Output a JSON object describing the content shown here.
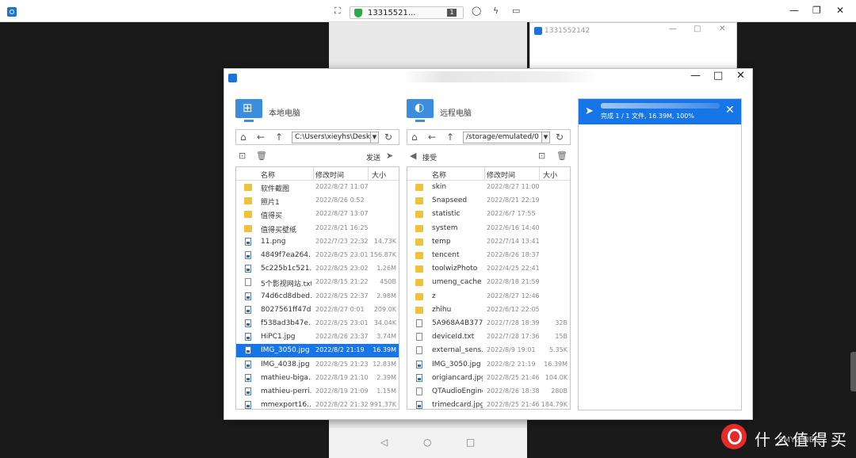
{
  "topbar": {
    "device_id": "13315521...",
    "connection_count": "1",
    "icons": [
      "fullscreen-icon",
      "shield-icon",
      "chat-icon",
      "flash-icon",
      "monitor-icon"
    ]
  },
  "bg_window": {
    "title": "1331552142"
  },
  "dialog": {
    "local": {
      "title": "本地电脑",
      "path": "C:\\Users\\xieyhs\\Desktop",
      "send_label": "发送",
      "columns": [
        "名称",
        "修改时间",
        "大小"
      ],
      "files": [
        {
          "name": "软件截图",
          "time": "2022/8/27 11:07",
          "size": "",
          "type": "folder"
        },
        {
          "name": "照片1",
          "time": "2022/8/26 0:52",
          "size": "",
          "type": "folder"
        },
        {
          "name": "值得买",
          "time": "2022/8/27 13:07",
          "size": "",
          "type": "folder"
        },
        {
          "name": "值得买壁纸",
          "time": "2022/8/21 16:25",
          "size": "",
          "type": "folder"
        },
        {
          "name": "11.png",
          "time": "2022/7/23 22:32",
          "size": "14.73K",
          "type": "img"
        },
        {
          "name": "4849f7ea264...",
          "time": "2022/8/25 23:01",
          "size": "156.87K",
          "type": "img"
        },
        {
          "name": "5c225b1c521...",
          "time": "2022/8/25 23:02",
          "size": "1.26M",
          "type": "img"
        },
        {
          "name": "5个影视网站.txt",
          "time": "2022/8/15 21:22",
          "size": "450B",
          "type": "file"
        },
        {
          "name": "74d6cd8dbed...",
          "time": "2022/8/25 22:37",
          "size": "2.98M",
          "type": "img"
        },
        {
          "name": "8027561ff47d...",
          "time": "2022/8/27 0:01",
          "size": "209.0K",
          "type": "img"
        },
        {
          "name": "f538ad3b47e...",
          "time": "2022/8/25 23:01",
          "size": "34.04K",
          "type": "img"
        },
        {
          "name": "HiPC1.jpg",
          "time": "2022/8/26 23:37",
          "size": "3.74M",
          "type": "img"
        },
        {
          "name": "IMG_3050.jpg",
          "time": "2022/8/2 21:19",
          "size": "16.39M",
          "type": "img",
          "selected": true
        },
        {
          "name": "IMG_4038.jpg",
          "time": "2022/8/25 21:23",
          "size": "12.83M",
          "type": "img"
        },
        {
          "name": "mathieu-biga...",
          "time": "2022/8/19 21:10",
          "size": "2.39M",
          "type": "img"
        },
        {
          "name": "mathieu-perri...",
          "time": "2022/8/19 21:09",
          "size": "1.15M",
          "type": "img"
        },
        {
          "name": "mmexport16...",
          "time": "2022/8/22 21:32",
          "size": "991.37K",
          "type": "img"
        }
      ]
    },
    "remote": {
      "title": "远程电脑",
      "path": "/storage/emulated/0",
      "receive_label": "接受",
      "columns": [
        "名称",
        "修改时间",
        "大小"
      ],
      "files": [
        {
          "name": "skin",
          "time": "2022/8/27 11:00",
          "size": "",
          "type": "folder"
        },
        {
          "name": "Snapseed",
          "time": "2022/8/21 22:19",
          "size": "",
          "type": "folder"
        },
        {
          "name": "statistic",
          "time": "2022/6/7 17:55",
          "size": "",
          "type": "folder"
        },
        {
          "name": "system",
          "time": "2022/6/16 14:40",
          "size": "",
          "type": "folder"
        },
        {
          "name": "temp",
          "time": "2022/7/14 13:41",
          "size": "",
          "type": "folder"
        },
        {
          "name": "tencent",
          "time": "2022/8/26 18:37",
          "size": "",
          "type": "folder"
        },
        {
          "name": "toolwizPhoto",
          "time": "2022/4/25 22:41",
          "size": "",
          "type": "folder"
        },
        {
          "name": "umeng_cache",
          "time": "2022/8/18 21:59",
          "size": "",
          "type": "folder"
        },
        {
          "name": "z",
          "time": "2022/8/27 12:46",
          "size": "",
          "type": "folder"
        },
        {
          "name": "zhihu",
          "time": "2022/6/12 22:05",
          "size": "",
          "type": "folder"
        },
        {
          "name": "5A968A4B377...",
          "time": "2022/7/28 18:39",
          "size": "32B",
          "type": "file"
        },
        {
          "name": "deviceId.txt",
          "time": "2022/7/28 17:36",
          "size": "15B",
          "type": "file"
        },
        {
          "name": "external_sens...",
          "time": "2022/8/9 19:01",
          "size": "5.35K",
          "type": "file"
        },
        {
          "name": "IMG_3050.jpg",
          "time": "2022/8/2 21:19",
          "size": "16.39M",
          "type": "img"
        },
        {
          "name": "origiancard.jpg",
          "time": "2022/8/25 21:46",
          "size": "104.0K",
          "type": "img"
        },
        {
          "name": "QTAudioEngine",
          "time": "2022/8/26 18:38",
          "size": "280B",
          "type": "file"
        },
        {
          "name": "trimedcard.jpg",
          "time": "2022/8/25 21:46",
          "size": "184.79K",
          "type": "img"
        }
      ]
    },
    "transfer": {
      "status": "完成 1 / 1 文件, 16.39M, 100%",
      "progress_percent": 100
    }
  },
  "watermark": {
    "text": "什么值得买",
    "sub": "SMYZ.NET"
  },
  "colors": {
    "accent": "#1676e8",
    "folder": "#f0c23b"
  }
}
